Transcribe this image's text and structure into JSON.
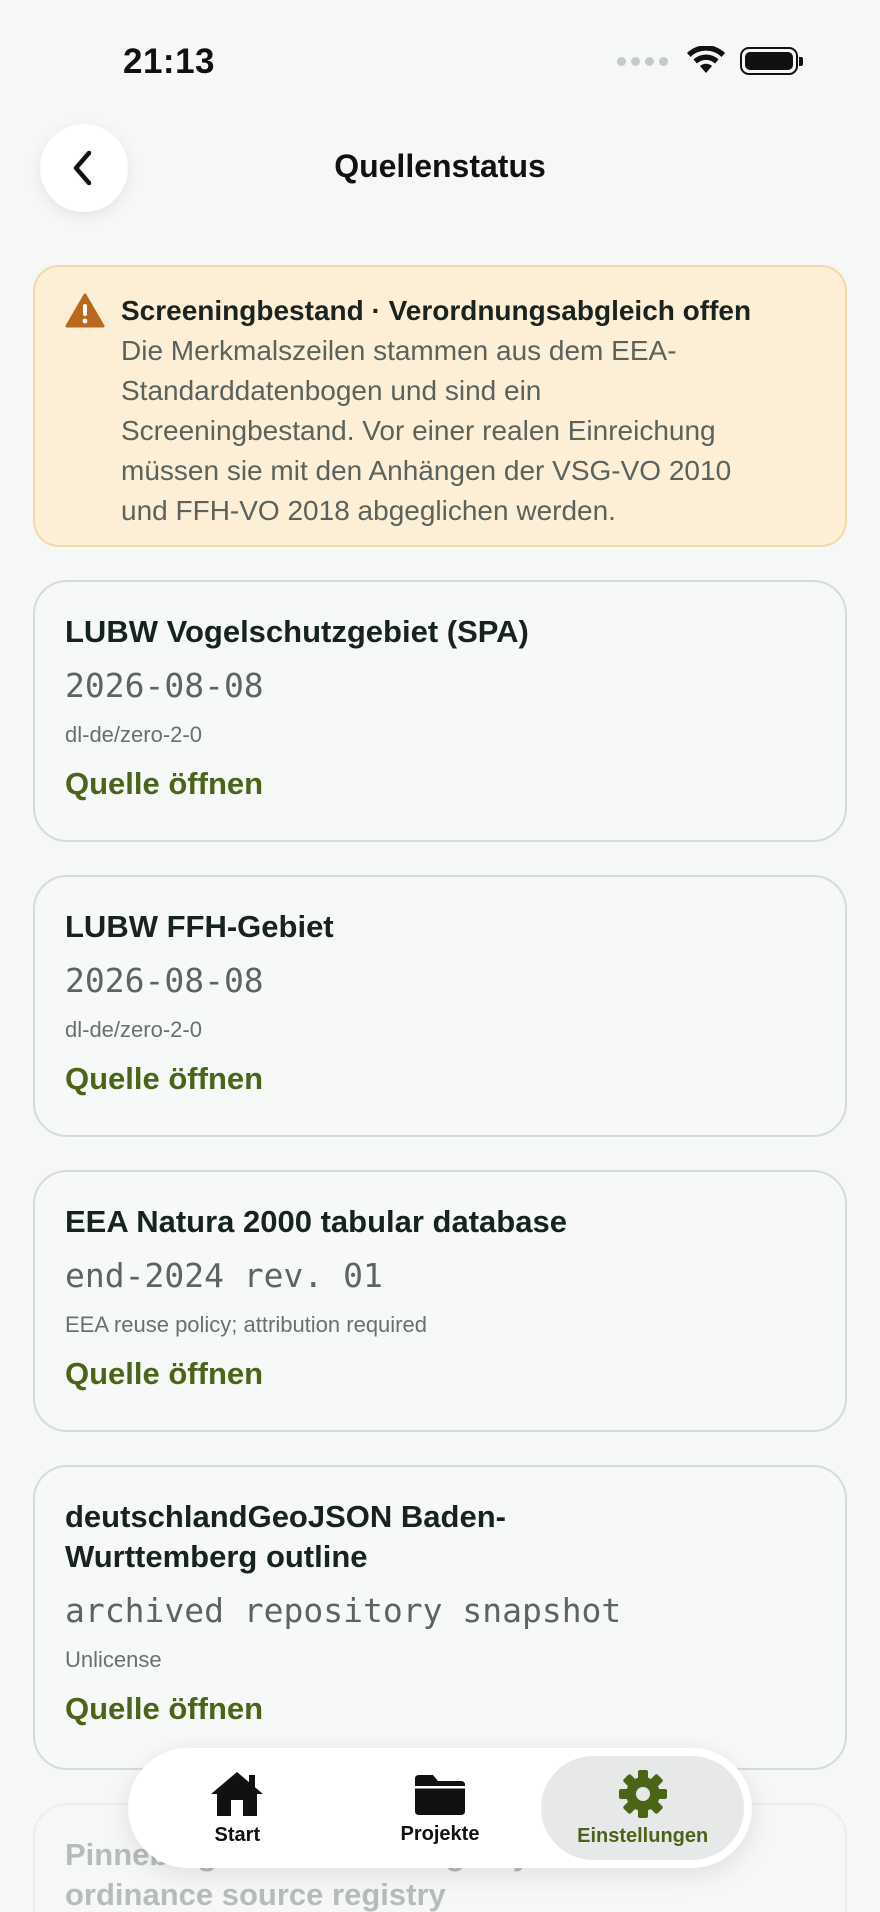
{
  "status_bar": {
    "time": "21:13"
  },
  "header": {
    "title": "Quellenstatus",
    "back_icon": "chevron-left-icon"
  },
  "banner": {
    "title": "Screeningbestand · Verordnungsabgleich offen",
    "text_lines": [
      "Die Merkmalszeilen stammen aus dem EEA-",
      "Standarddatenbogen und sind ein",
      "Screeningbestand. Vor einer realen Einreichung",
      "müssen sie mit den Anhängen der VSG-VO 2010",
      "und FFH-VO 2018 abgeglichen werden."
    ],
    "icon": "warning-triangle-icon",
    "colors": {
      "background": "#fdefd6",
      "border": "#f1d9a8",
      "icon": "#b8691d"
    }
  },
  "sources": [
    {
      "title_lines": [
        "LUBW Vogelschutzgebiet (SPA)"
      ],
      "version": "2026-08-08",
      "license": "dl-de/zero-2-0",
      "link": "Quelle öffnen"
    },
    {
      "title_lines": [
        "LUBW FFH-Gebiet"
      ],
      "version": "2026-08-08",
      "license": "dl-de/zero-2-0",
      "link": "Quelle öffnen"
    },
    {
      "title_lines": [
        "EEA Natura 2000 tabular database"
      ],
      "version": "end-2024 rev. 01",
      "license": "EEA reuse policy; attribution required",
      "link": "Quelle öffnen"
    },
    {
      "title_lines": [
        "deutschlandGeoJSON Baden-",
        "Wurttemberg outline"
      ],
      "version": "archived repository snapshot",
      "license": "Unlicense",
      "link": "Quelle öffnen"
    },
    {
      "title_lines": [
        "Pinneberg ordinance ... registry",
        "ordinance source registry"
      ],
      "version": "",
      "license": "",
      "link": ""
    }
  ],
  "tabbar": {
    "items": [
      {
        "label": "Start",
        "icon": "home-icon"
      },
      {
        "label": "Projekte",
        "icon": "folder-icon"
      },
      {
        "label": "Einstellungen",
        "icon": "gear-icon",
        "active": true
      }
    ]
  },
  "colors": {
    "accent": "#4a6418",
    "background": "#f6f7f7"
  }
}
